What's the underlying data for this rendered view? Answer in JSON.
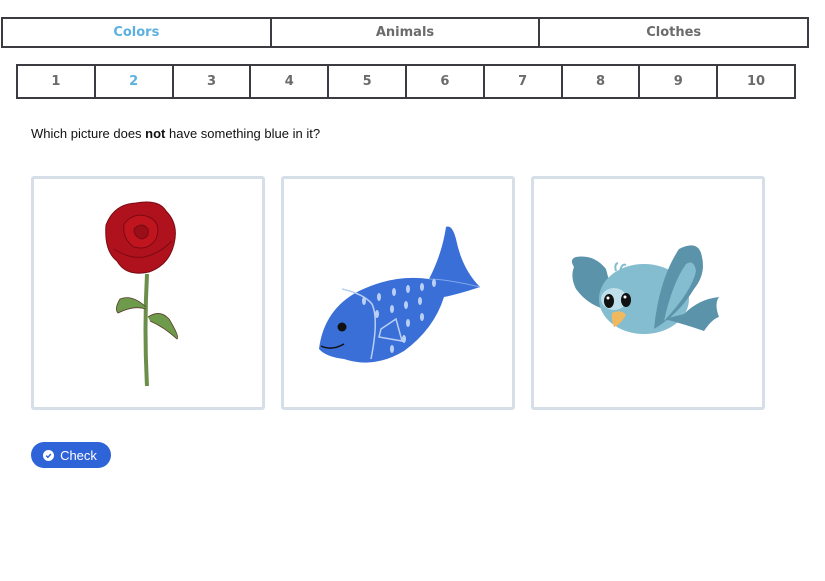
{
  "tabs": [
    {
      "label": "Colors",
      "active": true
    },
    {
      "label": "Animals",
      "active": false
    },
    {
      "label": "Clothes",
      "active": false
    }
  ],
  "question_numbers": [
    {
      "label": "1",
      "active": false
    },
    {
      "label": "2",
      "active": true
    },
    {
      "label": "3",
      "active": false
    },
    {
      "label": "4",
      "active": false
    },
    {
      "label": "5",
      "active": false
    },
    {
      "label": "6",
      "active": false
    },
    {
      "label": "7",
      "active": false
    },
    {
      "label": "8",
      "active": false
    },
    {
      "label": "9",
      "active": false
    },
    {
      "label": "10",
      "active": false
    }
  ],
  "question": {
    "prefix": "Which picture does ",
    "emphasis": "not",
    "suffix": " have something blue in it?"
  },
  "choices": [
    {
      "subject": "red rose",
      "icon": "rose-image"
    },
    {
      "subject": "blue fish",
      "icon": "fish-image"
    },
    {
      "subject": "blue bird",
      "icon": "bird-image"
    }
  ],
  "check_button": {
    "label": "Check",
    "icon": "check-circle-icon"
  },
  "colors": {
    "active_tab": "#5bb0e0",
    "button": "#2f63d8",
    "card_border": "#d6dee8"
  }
}
